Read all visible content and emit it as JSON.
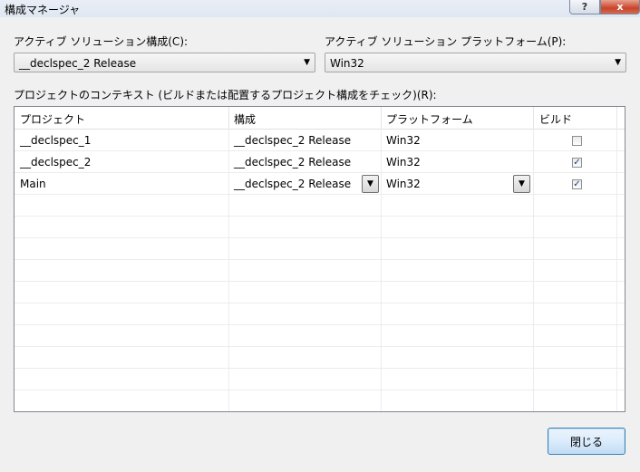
{
  "window": {
    "title": "構成マネージャ",
    "help_glyph": "?",
    "close_glyph": "x"
  },
  "active_config": {
    "label": "アクティブ ソリューション構成(C):",
    "value": "__declspec_2 Release"
  },
  "active_platform": {
    "label": "アクティブ ソリューション プラットフォーム(P):",
    "value": "Win32"
  },
  "context_label": "プロジェクトのコンテキスト (ビルドまたは配置するプロジェクト構成をチェック)(R):",
  "columns": [
    "プロジェクト",
    "構成",
    "プラットフォーム",
    "ビルド"
  ],
  "rows": [
    {
      "project": "__declspec_1",
      "config": "__declspec_2 Release",
      "platform": "Win32",
      "build": false
    },
    {
      "project": "__declspec_2",
      "config": "__declspec_2 Release",
      "platform": "Win32",
      "build": true
    },
    {
      "project": "Main",
      "config": "__declspec_2 Release",
      "platform": "Win32",
      "build": true
    }
  ],
  "close_button": "閉じる",
  "dropdown_glyph": "▼",
  "check_glyph": "✓"
}
